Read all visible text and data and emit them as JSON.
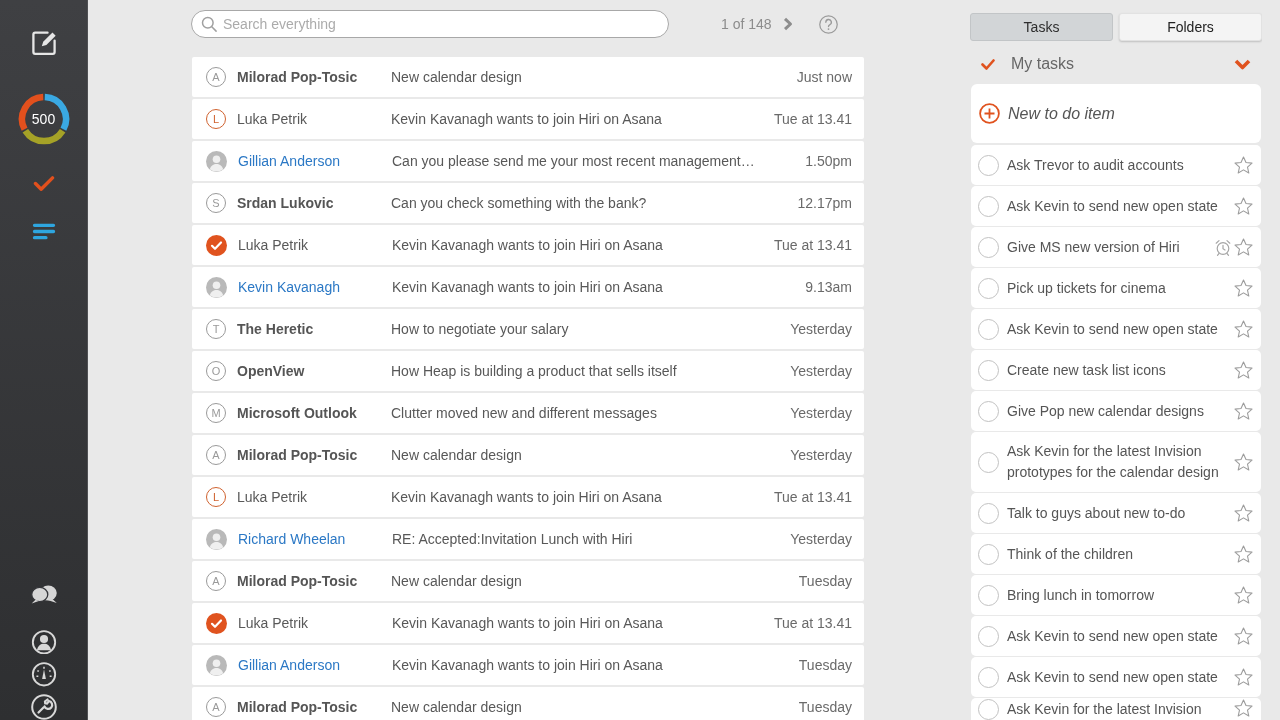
{
  "sidebar": {
    "badge": "500"
  },
  "search": {
    "placeholder": "Search everything"
  },
  "pager": {
    "text": "1 of 148"
  },
  "emails": [
    {
      "done": false,
      "avatar": {
        "kind": "letter",
        "letter": "A",
        "color": "#9a9a9a"
      },
      "sender": "Milorad Pop-Tosic",
      "unread": true,
      "contact": false,
      "subject": "New calendar design",
      "time": "Just now"
    },
    {
      "done": false,
      "avatar": {
        "kind": "letter",
        "letter": "L",
        "color": "#d0622f"
      },
      "sender": "Luka Petrik",
      "unread": false,
      "contact": false,
      "subject": "Kevin Kavanagh wants to join Hiri on Asana",
      "time": "Tue at 13.41"
    },
    {
      "done": false,
      "avatar": {
        "kind": "photo"
      },
      "sender": "Gillian Anderson",
      "unread": false,
      "contact": true,
      "subject": "Can you please send me your most recent management…",
      "time": "1.50pm"
    },
    {
      "done": false,
      "avatar": {
        "kind": "letter",
        "letter": "S",
        "color": "#9a9a9a"
      },
      "sender": "Srdan Lukovic",
      "unread": true,
      "contact": false,
      "subject": "Can you check something with the bank?",
      "time": "12.17pm"
    },
    {
      "done": true,
      "sender": "Luka Petrik",
      "unread": false,
      "contact": false,
      "subject": "Kevin Kavanagh wants to join Hiri on Asana",
      "time": "Tue at 13.41"
    },
    {
      "done": false,
      "avatar": {
        "kind": "photo"
      },
      "sender": "Kevin Kavanagh",
      "unread": false,
      "contact": true,
      "subject": "Kevin Kavanagh wants to join Hiri on Asana",
      "time": "9.13am"
    },
    {
      "done": false,
      "avatar": {
        "kind": "letter",
        "letter": "T",
        "color": "#9a9a9a"
      },
      "sender": "The Heretic",
      "unread": true,
      "contact": false,
      "subject": "How to negotiate your salary",
      "time": "Yesterday"
    },
    {
      "done": false,
      "avatar": {
        "kind": "letter",
        "letter": "O",
        "color": "#9a9a9a"
      },
      "sender": "OpenView",
      "unread": true,
      "contact": false,
      "subject": "How Heap is building a product that sells itself",
      "time": "Yesterday"
    },
    {
      "done": false,
      "avatar": {
        "kind": "letter",
        "letter": "M",
        "color": "#9a9a9a"
      },
      "sender": "Microsoft Outlook",
      "unread": true,
      "contact": false,
      "subject": "Clutter moved new and different messages",
      "time": "Yesterday"
    },
    {
      "done": false,
      "avatar": {
        "kind": "letter",
        "letter": "A",
        "color": "#9a9a9a"
      },
      "sender": "Milorad Pop-Tosic",
      "unread": true,
      "contact": false,
      "subject": "New calendar design",
      "time": "Yesterday"
    },
    {
      "done": false,
      "avatar": {
        "kind": "letter",
        "letter": "L",
        "color": "#d0622f"
      },
      "sender": "Luka Petrik",
      "unread": false,
      "contact": false,
      "subject": "Kevin Kavanagh wants to join Hiri on Asana",
      "time": "Tue at 13.41"
    },
    {
      "done": false,
      "avatar": {
        "kind": "photo"
      },
      "sender": "Richard Wheelan",
      "unread": false,
      "contact": true,
      "subject": "RE: Accepted:Invitation Lunch with Hiri",
      "time": "Yesterday"
    },
    {
      "done": false,
      "avatar": {
        "kind": "letter",
        "letter": "A",
        "color": "#9a9a9a"
      },
      "sender": "Milorad Pop-Tosic",
      "unread": true,
      "contact": false,
      "subject": "New calendar design",
      "time": "Tuesday"
    },
    {
      "done": true,
      "sender": "Luka Petrik",
      "unread": false,
      "contact": false,
      "subject": "Kevin Kavanagh wants to join Hiri on Asana",
      "time": "Tue at 13.41"
    },
    {
      "done": false,
      "avatar": {
        "kind": "photo"
      },
      "sender": "Gillian Anderson",
      "unread": false,
      "contact": true,
      "subject": "Kevin Kavanagh wants to join Hiri on Asana",
      "time": "Tuesday"
    },
    {
      "done": false,
      "avatar": {
        "kind": "letter",
        "letter": "A",
        "color": "#9a9a9a"
      },
      "sender": "Milorad Pop-Tosic",
      "unread": true,
      "contact": false,
      "subject": "New calendar design",
      "time": "Tuesday"
    }
  ],
  "task_tabs": [
    {
      "label": "Tasks",
      "selected": true
    },
    {
      "label": "Folders",
      "selected": false
    }
  ],
  "task_list": {
    "title": "My tasks",
    "expanded": true,
    "new_item": {
      "placeholder": "New to do item"
    },
    "tasks": [
      {
        "text": "Ask Trevor to audit accounts",
        "done": false,
        "starred": false,
        "reminder": false
      },
      {
        "text": "Ask Kevin to send new open state",
        "done": false,
        "starred": false,
        "reminder": false
      },
      {
        "text": "Give MS new version of Hiri",
        "done": false,
        "starred": false,
        "reminder": true
      },
      {
        "text": "Pick up tickets for cinema",
        "done": false,
        "starred": false,
        "reminder": false
      },
      {
        "text": "Ask Kevin to send new open state",
        "done": false,
        "starred": false,
        "reminder": false
      },
      {
        "text": "Create new task list icons",
        "done": false,
        "starred": false,
        "reminder": false
      },
      {
        "text": "Give Pop new calendar designs",
        "done": false,
        "starred": false,
        "reminder": false
      },
      {
        "text": "Ask Kevin for the latest Invision prototypes for the calendar design",
        "done": false,
        "starred": false,
        "reminder": false
      },
      {
        "text": "Talk to guys about new to-do",
        "done": false,
        "starred": false,
        "reminder": false
      },
      {
        "text": "Think of the children",
        "done": false,
        "starred": false,
        "reminder": false
      },
      {
        "text": "Bring lunch in tomorrow",
        "done": false,
        "starred": false,
        "reminder": false
      },
      {
        "text": "Ask Kevin to send new open state",
        "done": false,
        "starred": false,
        "reminder": false
      },
      {
        "text": "Ask Kevin to send new open state",
        "done": false,
        "starred": false,
        "reminder": false
      },
      {
        "text": "Ask Kevin for the latest Invision",
        "done": false,
        "starred": false,
        "reminder": false
      }
    ]
  }
}
